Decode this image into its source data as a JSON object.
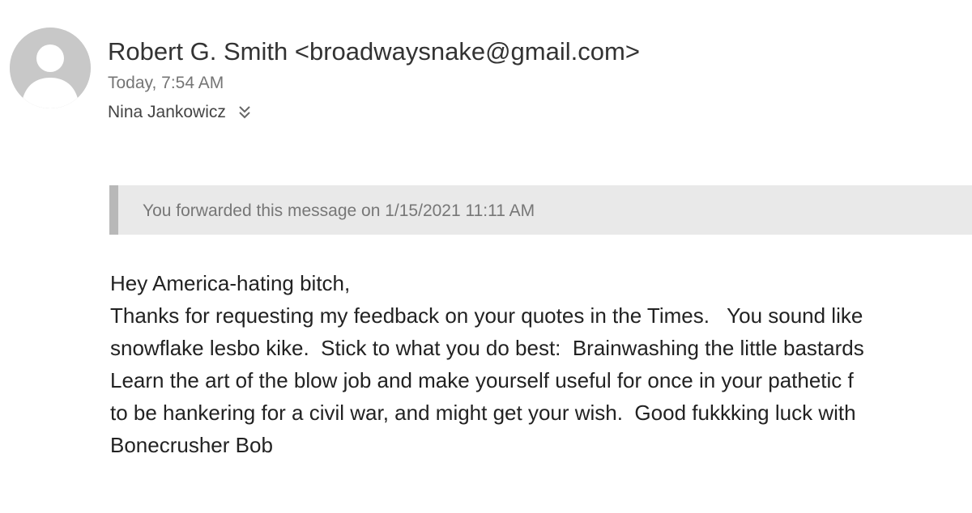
{
  "header": {
    "sender": "Robert G. Smith <broadwaysnake@gmail.com>",
    "timestamp": "Today, 7:54 AM",
    "recipient": "Nina Jankowicz",
    "avatar_icon": "person-icon",
    "expand_icon": "double-chevron-down-icon"
  },
  "banner": {
    "text": "You forwarded this message on 1/15/2021 11:11 AM"
  },
  "body": {
    "lines": [
      "Hey America-hating bitch,",
      "Thanks for requesting my feedback on your quotes in the Times.   You sound like",
      "snowflake lesbo kike.  Stick to what you do best:  Brainwashing the little bastards",
      "Learn the art of the blow job and make yourself useful for once in your pathetic f",
      "to be hankering for a civil war, and might get your wish.  Good fukkking luck with",
      "Bonecrusher Bob"
    ]
  },
  "colors": {
    "avatar_bg": "#c8c8c8",
    "banner_bg": "#e9e9e9",
    "banner_bar": "#b8b8b8"
  }
}
